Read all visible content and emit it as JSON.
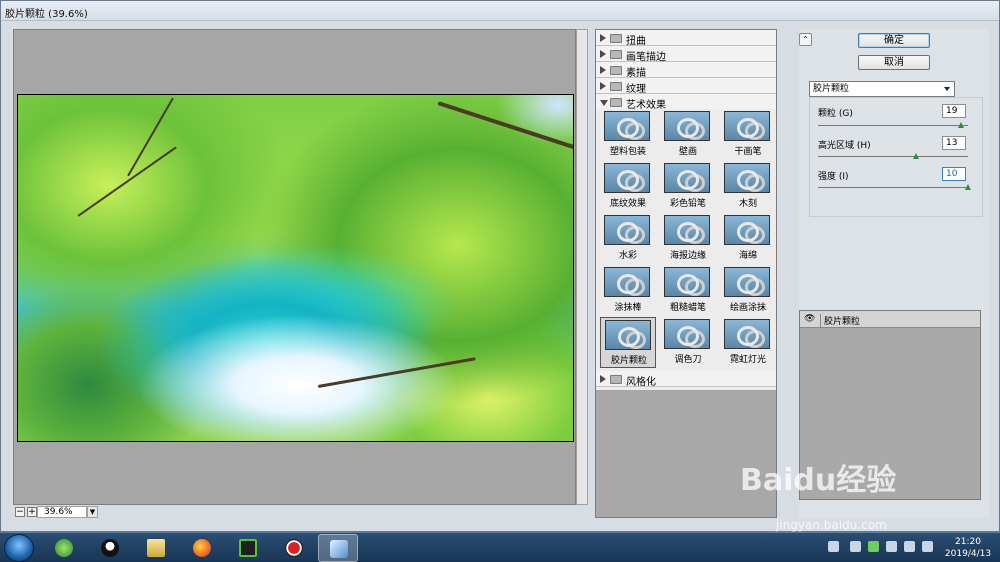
{
  "window": {
    "title": "胶片颗粒 (39.6%)"
  },
  "canvas": {
    "zoom": "39.6%",
    "zoom_out": "−",
    "zoom_in": "+"
  },
  "gallery": {
    "categories_top": [
      {
        "label": "扭曲",
        "open": false
      },
      {
        "label": "画笔描边",
        "open": false
      },
      {
        "label": "素描",
        "open": false
      },
      {
        "label": "纹理",
        "open": false
      },
      {
        "label": "艺术效果",
        "open": true
      }
    ],
    "thumbnails": [
      {
        "label": "塑料包装"
      },
      {
        "label": "壁画"
      },
      {
        "label": "干画笔"
      },
      {
        "label": "底纹效果"
      },
      {
        "label": "彩色铅笔"
      },
      {
        "label": "木刻"
      },
      {
        "label": "水彩"
      },
      {
        "label": "海报边缘"
      },
      {
        "label": "海绵"
      },
      {
        "label": "涂抹棒"
      },
      {
        "label": "粗糙蜡笔"
      },
      {
        "label": "绘画涂抹"
      },
      {
        "label": "胶片颗粒",
        "selected": true
      },
      {
        "label": "调色刀"
      },
      {
        "label": "霓虹灯光"
      }
    ],
    "category_bottom": {
      "label": "风格化",
      "open": false
    }
  },
  "buttons": {
    "ok": "确定",
    "cancel": "取消",
    "collapse": "⌃"
  },
  "filter": {
    "selected": "胶片颗粒"
  },
  "params": {
    "grain": {
      "label": "颗粒 (G)",
      "value": "19",
      "level": 0.95
    },
    "highlight": {
      "label": "高光区域 (H)",
      "value": "13",
      "level": 0.65
    },
    "intensity": {
      "label": "强度 (I)",
      "value": "10",
      "level": 1.0
    }
  },
  "layers": {
    "item": "胶片颗粒"
  },
  "watermark": {
    "text": "Baidu经验",
    "sub": "jingyan.baidu.com"
  },
  "taskbar": {
    "time": "21:20",
    "date": "2019/4/13"
  },
  "colors": {
    "accent": "#3c7fb1",
    "slider_knob": "#2a8f3a",
    "taskbar": "#183553"
  }
}
